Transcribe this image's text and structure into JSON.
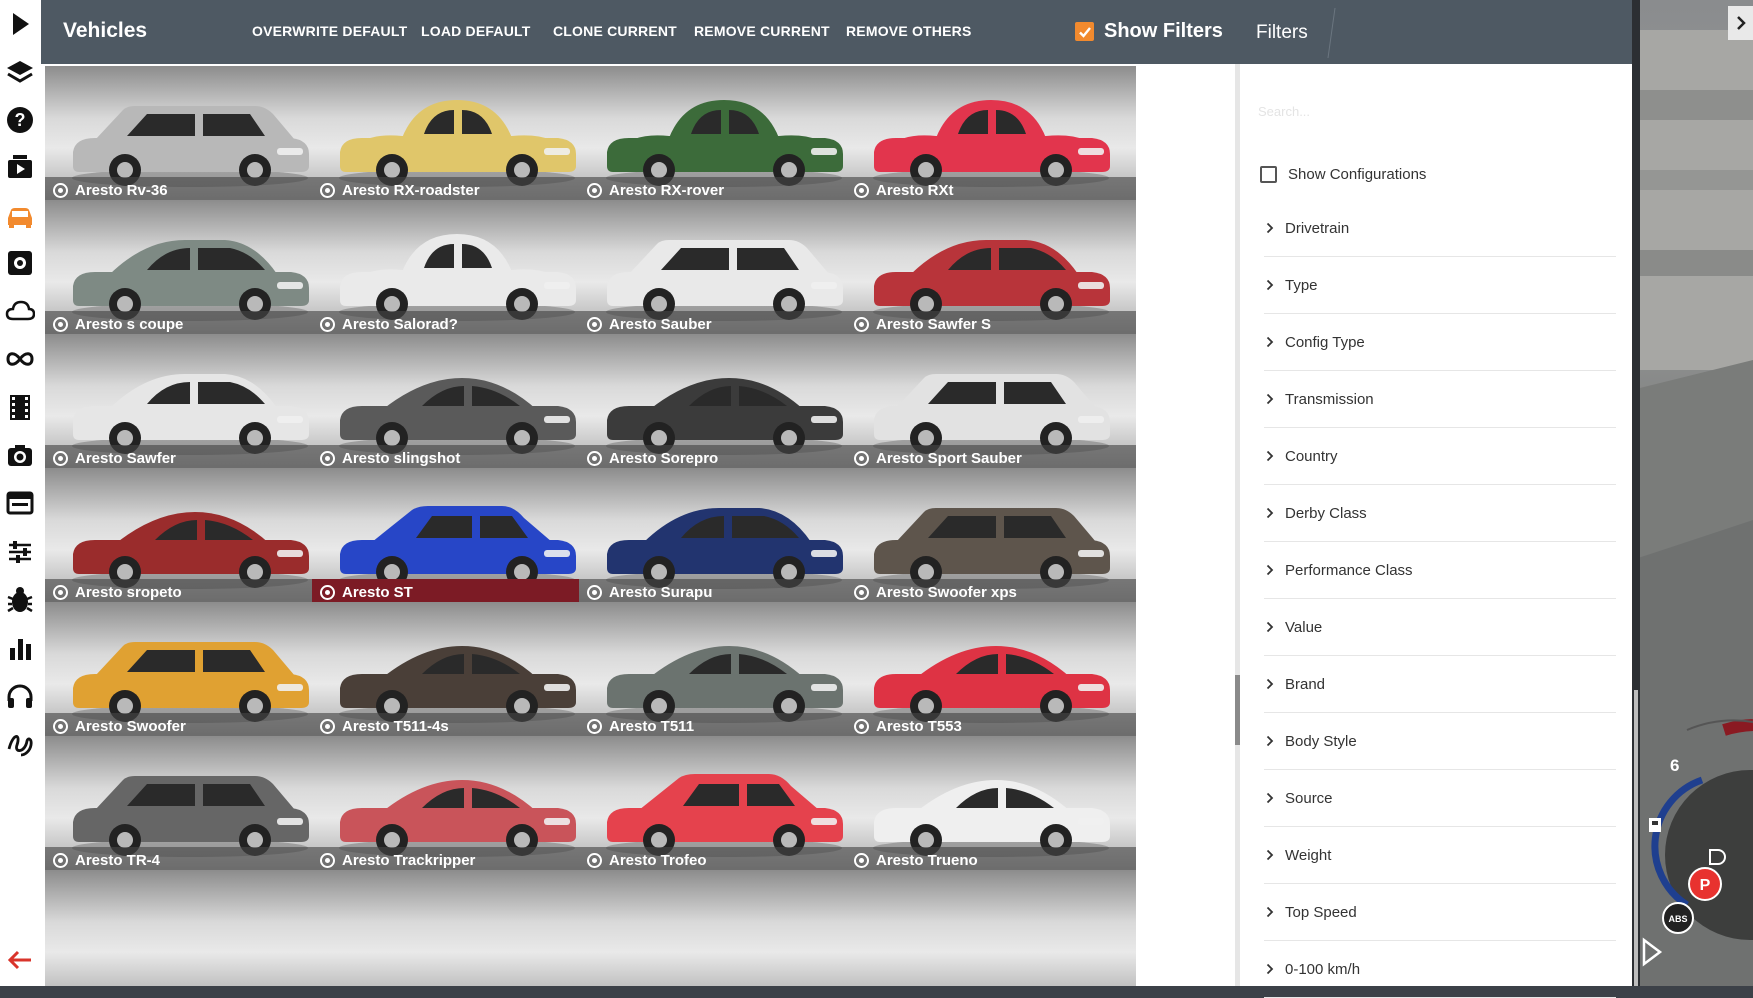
{
  "header": {
    "title": "Vehicles",
    "actions": [
      {
        "label": "OVERWRITE DEFAULT"
      },
      {
        "label": "LOAD DEFAULT"
      },
      {
        "label": "CLONE CURRENT"
      },
      {
        "label": "REMOVE CURRENT"
      },
      {
        "label": "REMOVE OTHERS"
      }
    ],
    "show_filters": {
      "label": "Show Filters",
      "checked": true
    }
  },
  "colors": {
    "accent": "#f28a2e",
    "header_bg": "#4e5963",
    "selected_label": "#7c1b25"
  },
  "sidebar_icons": [
    "play-icon",
    "layers-icon",
    "help-icon",
    "video-icon",
    "car-icon",
    "gear-icon",
    "cloud-icon",
    "infinity-icon",
    "film-icon",
    "camera-icon",
    "window-icon",
    "sliders-icon",
    "bug-icon",
    "bar-chart-icon",
    "headset-icon",
    "scribble-icon",
    "back-arrow-icon"
  ],
  "vehicles": [
    {
      "name": "Aresto Rv-36",
      "color": "#b8b8b8",
      "body": "van"
    },
    {
      "name": "Aresto RX-roadster",
      "color": "#e0c66a",
      "body": "classic"
    },
    {
      "name": "Aresto RX-rover",
      "color": "#3c6b3a",
      "body": "classic"
    },
    {
      "name": "Aresto RXt",
      "color": "#e2354d",
      "body": "classic"
    },
    {
      "name": "Aresto s coupe",
      "color": "#7e8a84",
      "body": "sedan"
    },
    {
      "name": "Aresto Salorad?",
      "color": "#eaeaea",
      "body": "classic"
    },
    {
      "name": "Aresto Sauber",
      "color": "#e9e9e9",
      "body": "wagon"
    },
    {
      "name": "Aresto Sawfer S",
      "color": "#b8343a",
      "body": "sedan"
    },
    {
      "name": "Aresto Sawfer",
      "color": "#e6e6e6",
      "body": "sedan"
    },
    {
      "name": "Aresto slingshot",
      "color": "#5a5a5a",
      "body": "sport"
    },
    {
      "name": "Aresto Sorepro",
      "color": "#3b3b3b",
      "body": "sport"
    },
    {
      "name": "Aresto Sport Sauber",
      "color": "#e2e2e2",
      "body": "wagon"
    },
    {
      "name": "Aresto sropeto",
      "color": "#9a2c2c",
      "body": "sport"
    },
    {
      "name": "Aresto ST",
      "color": "#2746c7",
      "body": "hatch"
    },
    {
      "name": "Aresto Surapu",
      "color": "#22346f",
      "body": "sedan"
    },
    {
      "name": "Aresto Swoofer xps",
      "color": "#5e554c",
      "body": "wagon"
    },
    {
      "name": "Aresto Swoofer",
      "color": "#e0a132",
      "body": "wagon"
    },
    {
      "name": "Aresto T511-4s",
      "color": "#4a3f38",
      "body": "sport"
    },
    {
      "name": "Aresto T511",
      "color": "#6b736f",
      "body": "sport"
    },
    {
      "name": "Aresto T553",
      "color": "#de3344",
      "body": "sport"
    },
    {
      "name": "Aresto TR-4",
      "color": "#666666",
      "body": "wagon"
    },
    {
      "name": "Aresto Trackripper",
      "color": "#c9545a",
      "body": "sport"
    },
    {
      "name": "Aresto Trofeo",
      "color": "#e5424d",
      "body": "hatch"
    },
    {
      "name": "Aresto Trueno",
      "color": "#efefef",
      "body": "sport"
    }
  ],
  "selected_vehicle": "Aresto ST",
  "filters": {
    "title": "Filters",
    "search_placeholder": "Search...",
    "show_configurations": {
      "label": "Show Configurations",
      "checked": false
    },
    "categories": [
      "Drivetrain",
      "Type",
      "Config Type",
      "Transmission",
      "Country",
      "Derby Class",
      "Performance Class",
      "Value",
      "Brand",
      "Body Style",
      "Source",
      "Weight",
      "Top Speed",
      "0-100 km/h"
    ]
  },
  "dashboard": {
    "gear": "6"
  }
}
